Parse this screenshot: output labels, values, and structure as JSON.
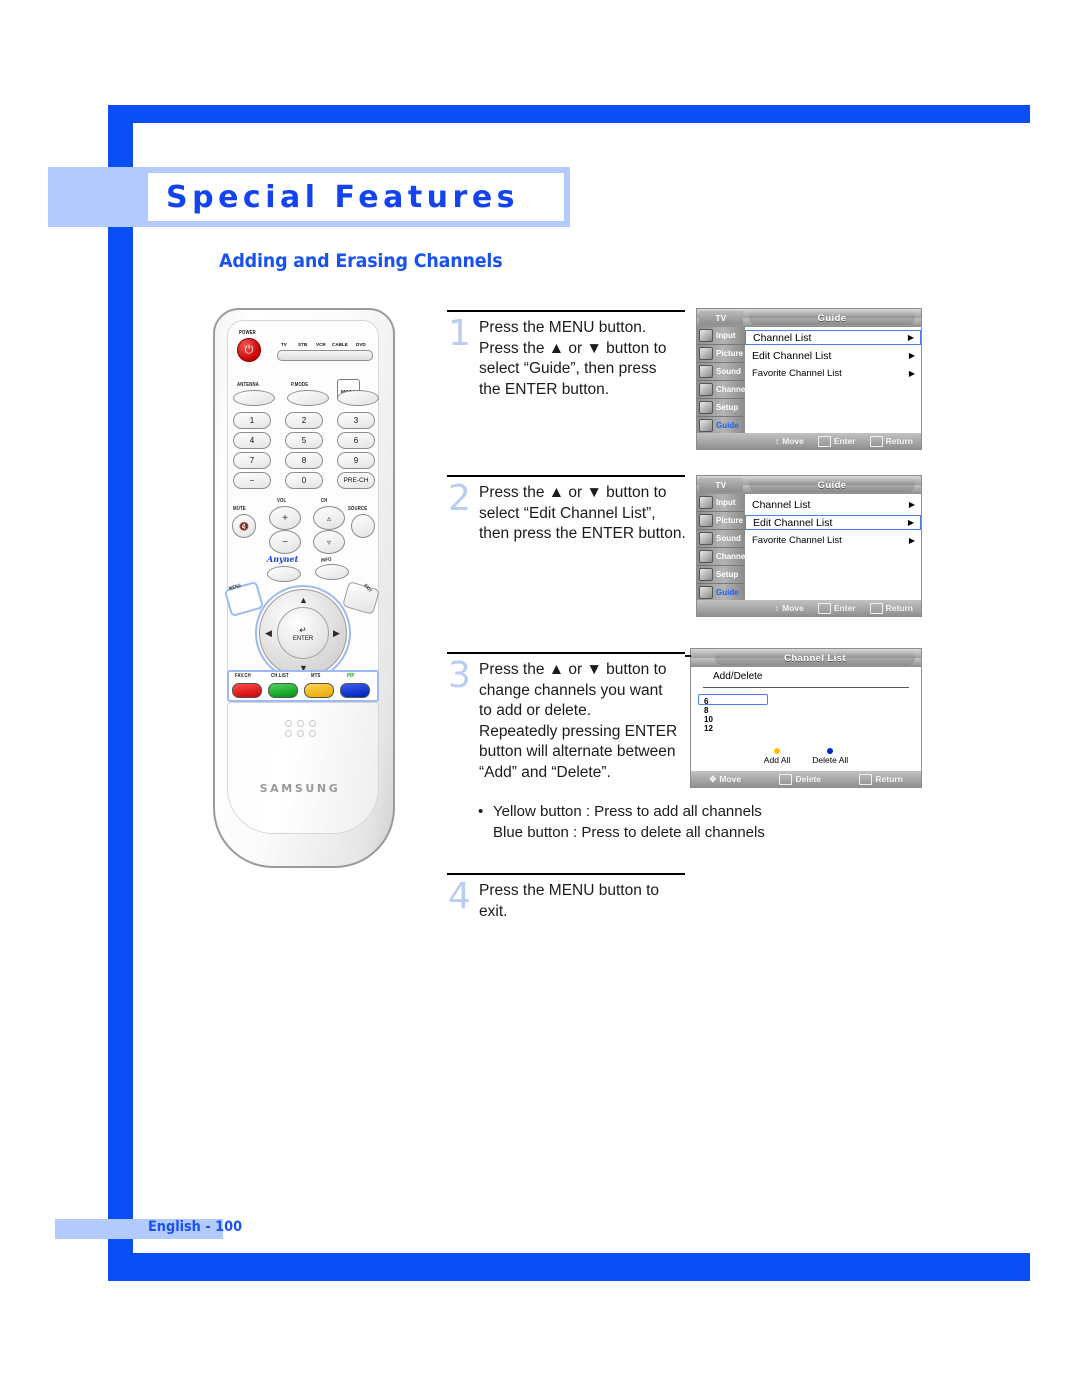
{
  "page": {
    "section_title": "Special Features",
    "subtitle": "Adding and Erasing Channels",
    "footer": "English - 100",
    "accent_blue": "#0a4ff5",
    "light_blue": "#b3caff",
    "step_number_color": "#b9cdf2"
  },
  "remote": {
    "brand": "SAMSUNG",
    "power_label": "POWER",
    "mode_labels": [
      "TV",
      "STB",
      "VCR",
      "CABLE",
      "DVD"
    ],
    "function_buttons": [
      "ANTENNA",
      "P.MODE",
      "MODE"
    ],
    "keypad": [
      "1",
      "2",
      "3",
      "4",
      "5",
      "6",
      "7",
      "8",
      "9",
      "−",
      "0",
      "PRE-CH"
    ],
    "vol_label": "VOL",
    "ch_label": "CH",
    "mute_label": "MUTE",
    "source_label": "SOURCE",
    "anynet_label": "Anynet",
    "info_label": "INFO",
    "menu_label": "MENU",
    "exit_label": "EXIT",
    "enter_label": "ENTER",
    "color_buttons": [
      {
        "label": "FAV.CH",
        "color": "#e4000f",
        "label_color": "#111111"
      },
      {
        "label": "CH.LIST",
        "color": "#00a60e",
        "label_color": "#111111"
      },
      {
        "label": "MTS",
        "color": "#ffc100",
        "label_color": "#111111"
      },
      {
        "label": "PIP",
        "color": "#0026d6",
        "label_color": "#00a60e"
      }
    ]
  },
  "steps": [
    {
      "number": "1",
      "lines": [
        "Press the MENU button.",
        "Press the ▲ or ▼ button to",
        "select “Guide”, then press",
        "the ENTER button."
      ]
    },
    {
      "number": "2",
      "lines": [
        "Press the ▲ or ▼ button to",
        "select “Edit Channel List”,",
        "then press the ENTER button."
      ]
    },
    {
      "number": "3",
      "lines": [
        "Press the ▲ or ▼ button to",
        "change channels you want",
        "to add or delete.",
        "Repeatedly pressing ENTER",
        "button will alternate between",
        "“Add” and “Delete”."
      ]
    },
    {
      "number": "4",
      "lines": [
        "Press the MENU button to",
        "exit."
      ]
    }
  ],
  "note": {
    "bullet": "•",
    "line1": "Yellow button : Press to add all channels",
    "line2": "Blue button : Press to delete all channels"
  },
  "osd": {
    "tv_label": "TV",
    "sidebar": [
      {
        "label": "Input",
        "icon": "input-icon",
        "active": false
      },
      {
        "label": "Picture",
        "icon": "picture-icon",
        "active": false
      },
      {
        "label": "Sound",
        "icon": "sound-icon",
        "active": false
      },
      {
        "label": "Channel",
        "icon": "channel-icon",
        "active": false
      },
      {
        "label": "Setup",
        "icon": "setup-icon",
        "active": false
      },
      {
        "label": "Guide",
        "icon": "guide-icon",
        "active": true
      }
    ],
    "guide_menu": {
      "title": "Guide",
      "rows": [
        "Channel List",
        "Edit Channel List",
        "Favorite Channel List"
      ],
      "arrow": "▶",
      "footer": [
        {
          "key": "move-key",
          "label": "Move"
        },
        {
          "key": "enter-key",
          "label": "Enter"
        },
        {
          "key": "return-key",
          "label": "Return"
        }
      ]
    },
    "panel1_selected_index": 0,
    "panel2_selected_index": 1,
    "channel_list": {
      "title": "Channel List",
      "subtitle": "Add/Delete",
      "channels": [
        "6",
        "8",
        "10",
        "12"
      ],
      "selected_index": 0,
      "add_all_label": "Add All",
      "delete_all_label": "Delete All",
      "add_all_color": "#ffc100",
      "delete_all_color": "#0026d6",
      "footer": [
        {
          "key": "move-key",
          "label": "Move"
        },
        {
          "key": "delete-key",
          "label": "Delete"
        },
        {
          "key": "return-key",
          "label": "Return"
        }
      ]
    }
  }
}
